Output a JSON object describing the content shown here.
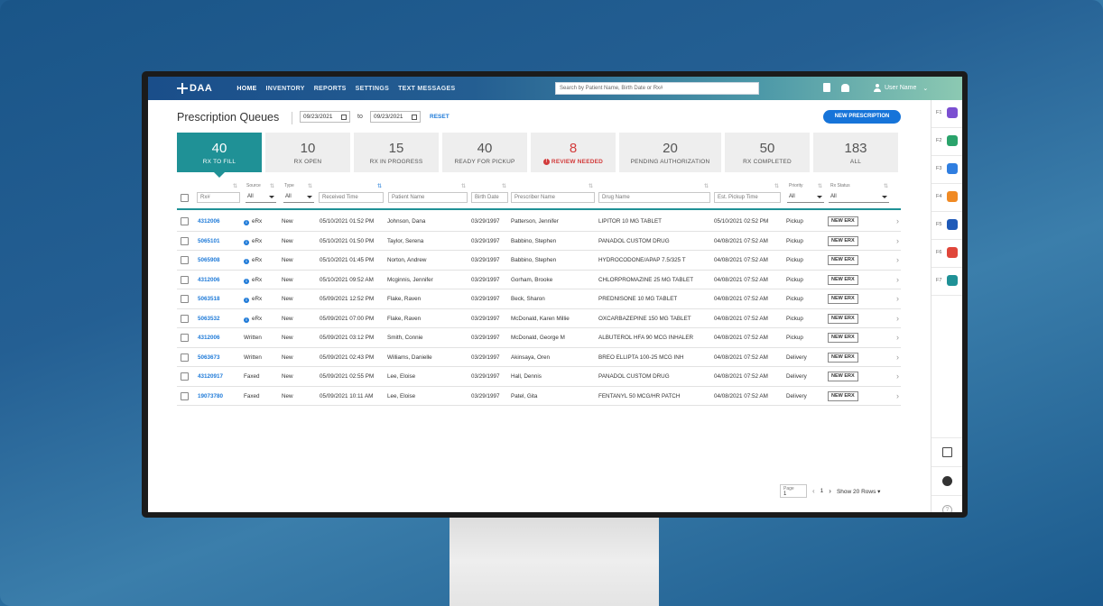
{
  "app": {
    "logo_text": "DAA",
    "nav": [
      "HOME",
      "INVENTORY",
      "REPORTS",
      "SETTINGS",
      "TEXT MESSAGES"
    ],
    "search_placeholder": "Search by Patient Name, Birth Date or Rx#",
    "user_name": "User Name"
  },
  "header": {
    "title": "Prescription Queues",
    "date_from": "09/23/2021",
    "to_label": "to",
    "date_to": "09/23/2021",
    "reset_label": "RESET",
    "new_prescription_label": "NEW PRESCRIPTION"
  },
  "tiles": [
    {
      "count": "40",
      "label": "RX TO FILL",
      "state": "active"
    },
    {
      "count": "10",
      "label": "RX OPEN",
      "state": "normal"
    },
    {
      "count": "15",
      "label": "RX IN PROGRESS",
      "state": "normal"
    },
    {
      "count": "40",
      "label": "READY FOR PICKUP",
      "state": "normal"
    },
    {
      "count": "8",
      "label": "REVIEW NEEDED",
      "state": "alert"
    },
    {
      "count": "20",
      "label": "PENDING AUTHORIZATION",
      "state": "normal"
    },
    {
      "count": "50",
      "label": "RX COMPLETED",
      "state": "normal"
    },
    {
      "count": "183",
      "label": "ALL",
      "state": "normal"
    }
  ],
  "filters": {
    "rx_placeholder": "Rx#",
    "source_label": "Source",
    "source_value": "All",
    "type_label": "Type",
    "type_value": "All",
    "received_placeholder": "Received Time",
    "patient_placeholder": "Patient Name",
    "birth_placeholder": "Birth Date",
    "prescriber_placeholder": "Prescriber Name",
    "drug_placeholder": "Drug Name",
    "pickup_placeholder": "Est. Pickup Time",
    "priority_label": "Priority",
    "priority_value": "All",
    "status_label": "Rx Status",
    "status_value": "All"
  },
  "rows": [
    {
      "rx": "4312006",
      "source": "eRx",
      "erx": true,
      "type": "New",
      "received": "05/10/2021 01:52 PM",
      "patient": "Johnson, Dana",
      "birth": "03/29/1997",
      "prescriber": "Patterson, Jennifer",
      "drug": "LIPITOR 10 MG TABLET",
      "pickup": "05/10/2021 02:52 PM",
      "priority": "Pickup",
      "status": "NEW ERX"
    },
    {
      "rx": "5065101",
      "source": "eRx",
      "erx": true,
      "type": "New",
      "received": "05/10/2021 01:50 PM",
      "patient": "Taylor, Serena",
      "birth": "03/29/1997",
      "prescriber": "Babbino, Stephen",
      "drug": "PANADOL CUSTOM DRUG",
      "pickup": "04/08/2021 07:52 AM",
      "priority": "Pickup",
      "status": "NEW ERX"
    },
    {
      "rx": "5065908",
      "source": "eRx",
      "erx": true,
      "type": "New",
      "received": "05/10/2021 01:45 PM",
      "patient": "Norton, Andrew",
      "birth": "03/29/1997",
      "prescriber": "Babbino, Stephen",
      "drug": "HYDROCODONE/APAP 7.5/325 T",
      "pickup": "04/08/2021 07:52 AM",
      "priority": "Pickup",
      "status": "NEW ERX"
    },
    {
      "rx": "4312006",
      "source": "eRx",
      "erx": true,
      "type": "New",
      "received": "05/10/2021 09:52 AM",
      "patient": "Mcginnis, Jennifer",
      "birth": "03/29/1997",
      "prescriber": "Gorham, Brooke",
      "drug": "CHLORPROMAZINE 25 MG TABLET",
      "pickup": "04/08/2021 07:52 AM",
      "priority": "Pickup",
      "status": "NEW ERX"
    },
    {
      "rx": "5063518",
      "source": "eRx",
      "erx": true,
      "type": "New",
      "received": "05/09/2021 12:52 PM",
      "patient": "Flake, Raven",
      "birth": "03/29/1997",
      "prescriber": "Beck, Sharon",
      "drug": "PREDNISONE 10 MG TABLET",
      "pickup": "04/08/2021 07:52 AM",
      "priority": "Pickup",
      "status": "NEW ERX"
    },
    {
      "rx": "5063532",
      "source": "eRx",
      "erx": true,
      "type": "New",
      "received": "05/09/2021 07:00 PM",
      "patient": "Flake, Raven",
      "birth": "03/29/1997",
      "prescriber": "McDonald, Karen Millie",
      "drug": "OXCARBAZEPINE 150 MG TABLET",
      "pickup": "04/08/2021 07:52 AM",
      "priority": "Pickup",
      "status": "NEW ERX"
    },
    {
      "rx": "4312006",
      "source": "Written",
      "erx": false,
      "type": "New",
      "received": "05/09/2021 03:12 PM",
      "patient": "Smith, Connie",
      "birth": "03/29/1997",
      "prescriber": "McDonald, George M",
      "drug": "ALBUTEROL HFA 90 MCG INHALER",
      "pickup": "04/08/2021 07:52 AM",
      "priority": "Pickup",
      "status": "NEW ERX"
    },
    {
      "rx": "5063673",
      "source": "Written",
      "erx": false,
      "type": "New",
      "received": "05/09/2021 02:43 PM",
      "patient": "Williams, Danielle",
      "birth": "03/29/1997",
      "prescriber": "Akinsaya, Oren",
      "drug": "BREO ELLIPTA 100-25 MCG INH",
      "pickup": "04/08/2021 07:52 AM",
      "priority": "Delivery",
      "status": "NEW ERX"
    },
    {
      "rx": "43120917",
      "source": "Faxed",
      "erx": false,
      "type": "New",
      "received": "05/09/2021 02:55 PM",
      "patient": "Lee, Eloise",
      "birth": "03/29/1997",
      "prescriber": "Hall, Dennis",
      "drug": "PANADOL CUSTOM DRUG",
      "pickup": "04/08/2021 07:52 AM",
      "priority": "Delivery",
      "status": "NEW ERX"
    },
    {
      "rx": "19073780",
      "source": "Faxed",
      "erx": false,
      "type": "New",
      "received": "05/09/2021 10:11 AM",
      "patient": "Lee, Eloise",
      "birth": "03/29/1997",
      "prescriber": "Patel, Gita",
      "drug": "FENTANYL 50 MCG/HR PATCH",
      "pickup": "04/08/2021 07:52 AM",
      "priority": "Delivery",
      "status": "NEW ERX"
    }
  ],
  "pager": {
    "page_label": "Page",
    "page_value": "1",
    "current": "1",
    "rows_label": "Show 20 Rows"
  },
  "rail": {
    "keys": [
      "F1",
      "F2",
      "F3",
      "F4",
      "F5",
      "F6",
      "F7"
    ],
    "icons": [
      "users-icon",
      "doctor-icon",
      "shield-plus-icon",
      "pills-icon",
      "pharmacy-store-icon",
      "home-delivery-icon",
      "person-icon"
    ],
    "colors": [
      "#7b4fd1",
      "#2aa36b",
      "#2f7ee0",
      "#f08a24",
      "#1f5ab8",
      "#e0463a",
      "#1f9196"
    ]
  }
}
